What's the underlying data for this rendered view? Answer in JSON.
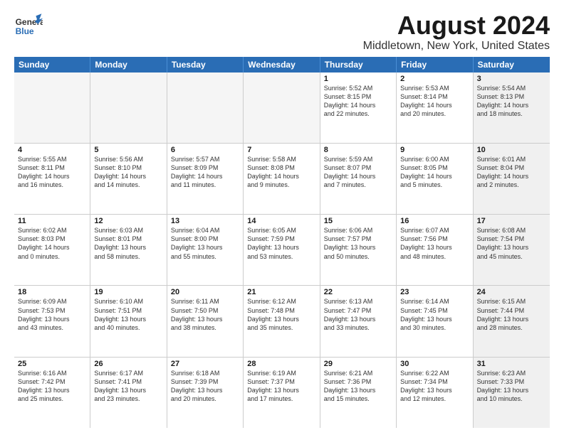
{
  "logo": {
    "line1": "General",
    "line2": "Blue"
  },
  "title": "August 2024",
  "subtitle": "Middletown, New York, United States",
  "days_of_week": [
    "Sunday",
    "Monday",
    "Tuesday",
    "Wednesday",
    "Thursday",
    "Friday",
    "Saturday"
  ],
  "weeks": [
    [
      {
        "day": "",
        "empty": true
      },
      {
        "day": "",
        "empty": true
      },
      {
        "day": "",
        "empty": true
      },
      {
        "day": "",
        "empty": true
      },
      {
        "day": "1",
        "info": "Sunrise: 5:52 AM\nSunset: 8:15 PM\nDaylight: 14 hours\nand 22 minutes."
      },
      {
        "day": "2",
        "info": "Sunrise: 5:53 AM\nSunset: 8:14 PM\nDaylight: 14 hours\nand 20 minutes."
      },
      {
        "day": "3",
        "info": "Sunrise: 5:54 AM\nSunset: 8:13 PM\nDaylight: 14 hours\nand 18 minutes.",
        "shaded": true
      }
    ],
    [
      {
        "day": "4",
        "info": "Sunrise: 5:55 AM\nSunset: 8:11 PM\nDaylight: 14 hours\nand 16 minutes."
      },
      {
        "day": "5",
        "info": "Sunrise: 5:56 AM\nSunset: 8:10 PM\nDaylight: 14 hours\nand 14 minutes."
      },
      {
        "day": "6",
        "info": "Sunrise: 5:57 AM\nSunset: 8:09 PM\nDaylight: 14 hours\nand 11 minutes."
      },
      {
        "day": "7",
        "info": "Sunrise: 5:58 AM\nSunset: 8:08 PM\nDaylight: 14 hours\nand 9 minutes."
      },
      {
        "day": "8",
        "info": "Sunrise: 5:59 AM\nSunset: 8:07 PM\nDaylight: 14 hours\nand 7 minutes."
      },
      {
        "day": "9",
        "info": "Sunrise: 6:00 AM\nSunset: 8:05 PM\nDaylight: 14 hours\nand 5 minutes."
      },
      {
        "day": "10",
        "info": "Sunrise: 6:01 AM\nSunset: 8:04 PM\nDaylight: 14 hours\nand 2 minutes.",
        "shaded": true
      }
    ],
    [
      {
        "day": "11",
        "info": "Sunrise: 6:02 AM\nSunset: 8:03 PM\nDaylight: 14 hours\nand 0 minutes."
      },
      {
        "day": "12",
        "info": "Sunrise: 6:03 AM\nSunset: 8:01 PM\nDaylight: 13 hours\nand 58 minutes."
      },
      {
        "day": "13",
        "info": "Sunrise: 6:04 AM\nSunset: 8:00 PM\nDaylight: 13 hours\nand 55 minutes."
      },
      {
        "day": "14",
        "info": "Sunrise: 6:05 AM\nSunset: 7:59 PM\nDaylight: 13 hours\nand 53 minutes."
      },
      {
        "day": "15",
        "info": "Sunrise: 6:06 AM\nSunset: 7:57 PM\nDaylight: 13 hours\nand 50 minutes."
      },
      {
        "day": "16",
        "info": "Sunrise: 6:07 AM\nSunset: 7:56 PM\nDaylight: 13 hours\nand 48 minutes."
      },
      {
        "day": "17",
        "info": "Sunrise: 6:08 AM\nSunset: 7:54 PM\nDaylight: 13 hours\nand 45 minutes.",
        "shaded": true
      }
    ],
    [
      {
        "day": "18",
        "info": "Sunrise: 6:09 AM\nSunset: 7:53 PM\nDaylight: 13 hours\nand 43 minutes."
      },
      {
        "day": "19",
        "info": "Sunrise: 6:10 AM\nSunset: 7:51 PM\nDaylight: 13 hours\nand 40 minutes."
      },
      {
        "day": "20",
        "info": "Sunrise: 6:11 AM\nSunset: 7:50 PM\nDaylight: 13 hours\nand 38 minutes."
      },
      {
        "day": "21",
        "info": "Sunrise: 6:12 AM\nSunset: 7:48 PM\nDaylight: 13 hours\nand 35 minutes."
      },
      {
        "day": "22",
        "info": "Sunrise: 6:13 AM\nSunset: 7:47 PM\nDaylight: 13 hours\nand 33 minutes."
      },
      {
        "day": "23",
        "info": "Sunrise: 6:14 AM\nSunset: 7:45 PM\nDaylight: 13 hours\nand 30 minutes."
      },
      {
        "day": "24",
        "info": "Sunrise: 6:15 AM\nSunset: 7:44 PM\nDaylight: 13 hours\nand 28 minutes.",
        "shaded": true
      }
    ],
    [
      {
        "day": "25",
        "info": "Sunrise: 6:16 AM\nSunset: 7:42 PM\nDaylight: 13 hours\nand 25 minutes."
      },
      {
        "day": "26",
        "info": "Sunrise: 6:17 AM\nSunset: 7:41 PM\nDaylight: 13 hours\nand 23 minutes."
      },
      {
        "day": "27",
        "info": "Sunrise: 6:18 AM\nSunset: 7:39 PM\nDaylight: 13 hours\nand 20 minutes."
      },
      {
        "day": "28",
        "info": "Sunrise: 6:19 AM\nSunset: 7:37 PM\nDaylight: 13 hours\nand 17 minutes."
      },
      {
        "day": "29",
        "info": "Sunrise: 6:21 AM\nSunset: 7:36 PM\nDaylight: 13 hours\nand 15 minutes."
      },
      {
        "day": "30",
        "info": "Sunrise: 6:22 AM\nSunset: 7:34 PM\nDaylight: 13 hours\nand 12 minutes."
      },
      {
        "day": "31",
        "info": "Sunrise: 6:23 AM\nSunset: 7:33 PM\nDaylight: 13 hours\nand 10 minutes.",
        "shaded": true
      }
    ]
  ]
}
